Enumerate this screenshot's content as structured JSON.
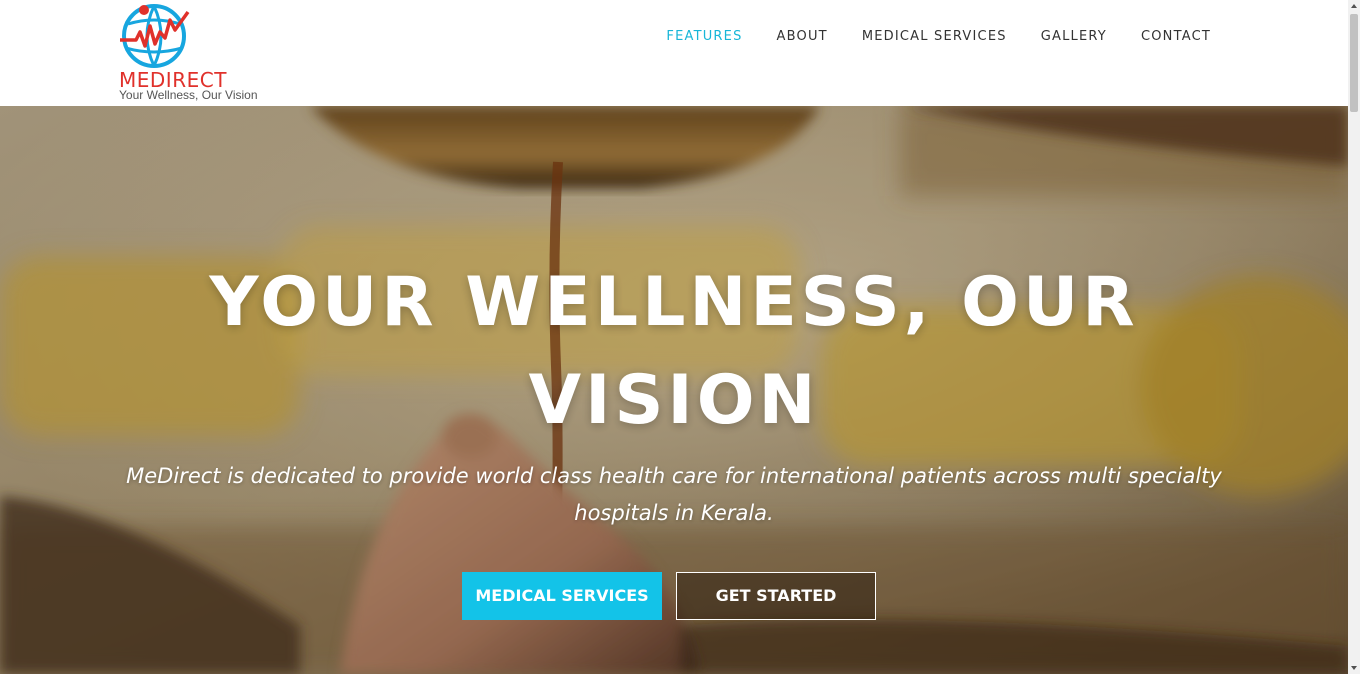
{
  "brand": {
    "name": "MEDIRECT",
    "tagline": "Your Wellness, Our Vision",
    "logo_icon": "globe-heartbeat-icon",
    "primary_color": "#e0312b",
    "secondary_color": "#17a6df"
  },
  "nav": {
    "items": [
      {
        "label": "FEATURES",
        "active": true
      },
      {
        "label": "ABOUT",
        "active": false
      },
      {
        "label": "MEDICAL SERVICES",
        "active": false
      },
      {
        "label": "GALLERY",
        "active": false
      },
      {
        "label": "CONTACT",
        "active": false
      }
    ],
    "active_color": "#17b6d8"
  },
  "hero": {
    "title": "YOUR WELLNESS, OUR VISION",
    "description": "MeDirect is dedicated to provide world class health care for international patients across multi specialty hospitals in Kerala.",
    "primary_button": "MEDICAL SERVICES",
    "secondary_button": "GET STARTED",
    "button_color": "#13c3e8"
  }
}
